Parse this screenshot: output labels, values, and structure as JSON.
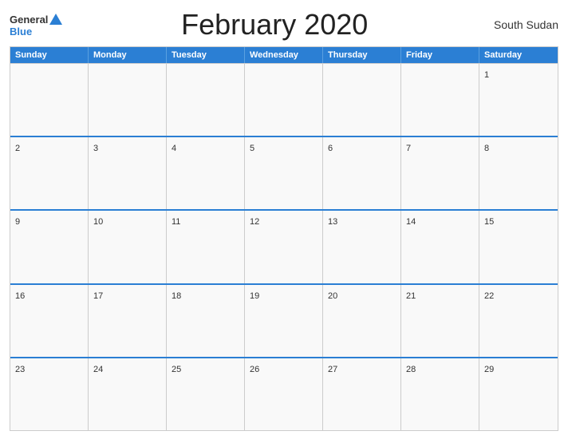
{
  "header": {
    "title": "February 2020",
    "country": "South Sudan",
    "logo_general": "General",
    "logo_blue": "Blue"
  },
  "days_of_week": [
    "Sunday",
    "Monday",
    "Tuesday",
    "Wednesday",
    "Thursday",
    "Friday",
    "Saturday"
  ],
  "weeks": [
    [
      {
        "day": "",
        "empty": true
      },
      {
        "day": "",
        "empty": true
      },
      {
        "day": "",
        "empty": true
      },
      {
        "day": "",
        "empty": true
      },
      {
        "day": "",
        "empty": true
      },
      {
        "day": "",
        "empty": true
      },
      {
        "day": "1",
        "empty": false
      }
    ],
    [
      {
        "day": "2",
        "empty": false
      },
      {
        "day": "3",
        "empty": false
      },
      {
        "day": "4",
        "empty": false
      },
      {
        "day": "5",
        "empty": false
      },
      {
        "day": "6",
        "empty": false
      },
      {
        "day": "7",
        "empty": false
      },
      {
        "day": "8",
        "empty": false
      }
    ],
    [
      {
        "day": "9",
        "empty": false
      },
      {
        "day": "10",
        "empty": false
      },
      {
        "day": "11",
        "empty": false
      },
      {
        "day": "12",
        "empty": false
      },
      {
        "day": "13",
        "empty": false
      },
      {
        "day": "14",
        "empty": false
      },
      {
        "day": "15",
        "empty": false
      }
    ],
    [
      {
        "day": "16",
        "empty": false
      },
      {
        "day": "17",
        "empty": false
      },
      {
        "day": "18",
        "empty": false
      },
      {
        "day": "19",
        "empty": false
      },
      {
        "day": "20",
        "empty": false
      },
      {
        "day": "21",
        "empty": false
      },
      {
        "day": "22",
        "empty": false
      }
    ],
    [
      {
        "day": "23",
        "empty": false
      },
      {
        "day": "24",
        "empty": false
      },
      {
        "day": "25",
        "empty": false
      },
      {
        "day": "26",
        "empty": false
      },
      {
        "day": "27",
        "empty": false
      },
      {
        "day": "28",
        "empty": false
      },
      {
        "day": "29",
        "empty": false
      }
    ]
  ]
}
